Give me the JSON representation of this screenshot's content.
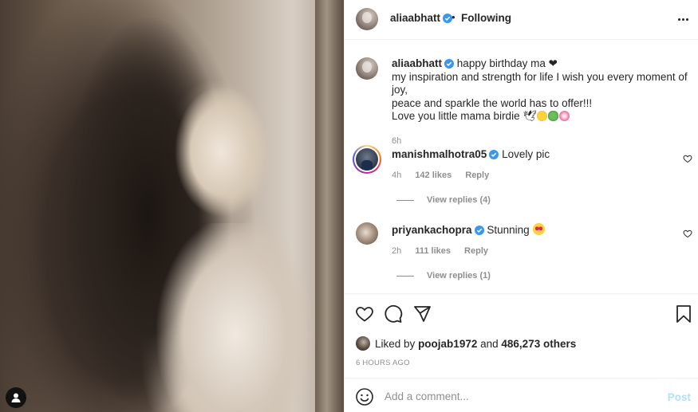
{
  "post": {
    "author": "aliaabhatt",
    "follow_status": "Following",
    "follow_dot": "•",
    "image_alt": "Sepia photograph of a woman with long dark hair looking over her shoulder"
  },
  "caption": {
    "username": "aliaabhatt",
    "line1": "happy birthday ma ❤",
    "line2": "my inspiration and strength for life I wish you every moment of joy,",
    "line3": "peace and sparkle the world has to offer!!!",
    "line4": "Love you little mama birdie 🕊",
    "time": "6h"
  },
  "comments": [
    {
      "username": "manishmalhotra05",
      "text": "Lovely pic",
      "time": "4h",
      "likes": "142 likes",
      "reply": "Reply",
      "view_replies": "View replies (4)"
    },
    {
      "username": "priyankachopra",
      "text": "Stunning",
      "time": "2h",
      "likes": "111 likes",
      "reply": "Reply",
      "view_replies": "View replies (1)"
    }
  ],
  "likes": {
    "prefix": "Liked by",
    "user": "poojab1972",
    "middle": "and",
    "count": "486,273 others"
  },
  "posted_ago": "6 HOURS AGO",
  "comment_box": {
    "placeholder": "Add a comment...",
    "post_label": "Post"
  },
  "colors": {
    "verified": "#3897f0",
    "muted": "#8e8e8e",
    "post_disabled": "#b2dffc"
  },
  "icons": [
    "like-icon",
    "comment-icon",
    "share-icon",
    "save-icon",
    "emoji-icon",
    "more-options-icon",
    "user-tag-icon",
    "verified-icon"
  ]
}
